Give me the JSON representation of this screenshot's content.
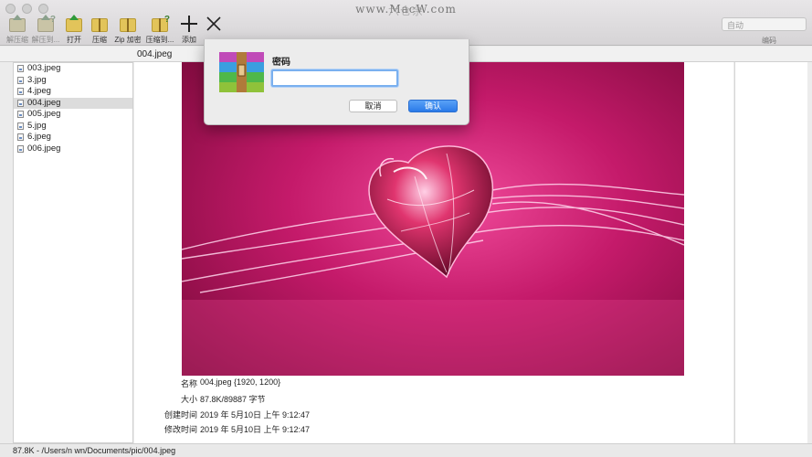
{
  "window": {
    "title": "六仓余",
    "watermark": "www.MacW.com"
  },
  "toolbar": {
    "tools": [
      {
        "label": "解压缩",
        "icon": "extract-icon",
        "enabled": false
      },
      {
        "label": "解压到...",
        "icon": "extract-to-icon",
        "enabled": false
      },
      {
        "label": "打开",
        "icon": "open-folder-icon",
        "enabled": true
      },
      {
        "label": "压缩",
        "icon": "compress-icon",
        "enabled": true
      },
      {
        "label": "Zip 加密",
        "icon": "zip-encrypt-icon",
        "enabled": true
      },
      {
        "label": "压缩到...",
        "icon": "compress-to-icon",
        "enabled": true
      },
      {
        "label": "添加",
        "icon": "add-icon",
        "enabled": true
      }
    ],
    "close_glyph": "×",
    "add_glyph": "+",
    "encoding_select": {
      "value": "自动",
      "label": "编码"
    }
  },
  "header": {
    "current_file": "004.jpeg"
  },
  "files": [
    {
      "name": "003.jpeg",
      "selected": false
    },
    {
      "name": "3.jpg",
      "selected": false
    },
    {
      "name": "4.jpeg",
      "selected": false
    },
    {
      "name": "004.jpeg",
      "selected": true
    },
    {
      "name": "005.jpeg",
      "selected": false
    },
    {
      "name": "5.jpg",
      "selected": false
    },
    {
      "name": "6.jpeg",
      "selected": false
    },
    {
      "name": "006.jpeg",
      "selected": false
    }
  ],
  "info": {
    "name_label": "名称",
    "name_value": "004.jpeg {1920, 1200}",
    "size_label": "大小",
    "size_value": "87.8K/89887 字节",
    "created_label": "创建时间",
    "created_value": "2019 年 5月10日 上午 9:12:47",
    "modified_label": "修改时间",
    "modified_value": "2019 年 5月10日 上午 9:12:47"
  },
  "status": {
    "text": "87.8K - /Users/n     wn/Documents/pic/004.jpeg"
  },
  "dialog": {
    "label": "密码",
    "password_value": "",
    "cancel_label": "取消",
    "ok_label": "确认"
  },
  "colors": {
    "accent": "#2a7ae8",
    "selection": "#dcdcdc",
    "image_base": "#c2185b"
  }
}
